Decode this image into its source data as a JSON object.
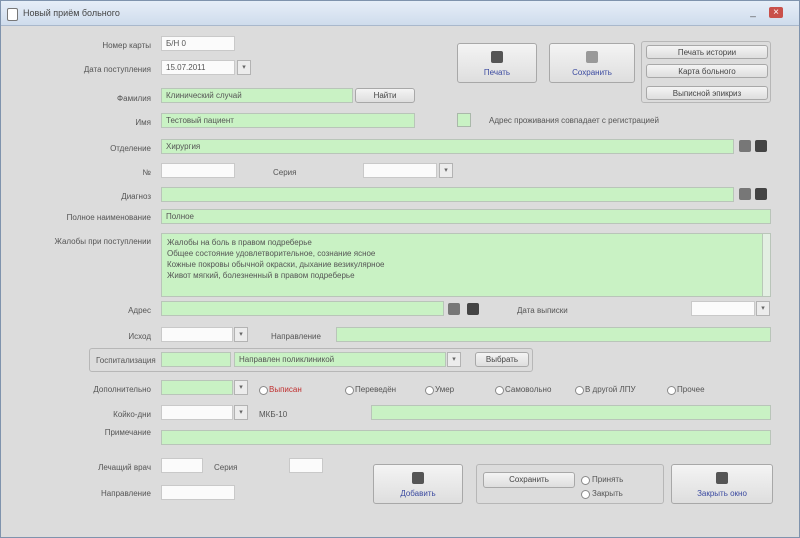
{
  "window": {
    "title": "Новый приём больного",
    "min": "_",
    "max": "□",
    "close": "×"
  },
  "labels": {
    "card_number": "Номер карты",
    "admission_date": "Дата поступления",
    "last_name": "Фамилия",
    "first_name": "Имя",
    "department": "Отделение",
    "number": "№",
    "series": "Серия",
    "diagnosis": "Диагноз",
    "surname_variant": "Полное наименование",
    "complaints": "Жалобы при поступлении",
    "address": "Адрес",
    "result_date": "Дата выписки",
    "outcome": "Исход",
    "referral": "Направление",
    "stay": "Госпитализация",
    "additional": "Дополнительно",
    "days_count": "Койко-дни",
    "notes": "Примечание",
    "doctor": "Лечащий врач"
  },
  "values": {
    "card_number": "Б/Н 0",
    "admission_date": "15.07.2011",
    "last_name": "Клинический случай",
    "first_name": "Тестовый пациент",
    "department": "Хирургия",
    "diagnosis": "",
    "full_name": "Полное",
    "complaints_line1": "Жалобы на боль в правом подреберье",
    "complaints_line2": "Общее состояние удовлетворительное, сознание ясное",
    "complaints_line3": "Кожные покровы обычной окраски, дыхание везикулярное",
    "complaints_line4": "Живот мягкий, болезненный в правом подреберье",
    "referral_text": "Направлен поликлиникой"
  },
  "buttons": {
    "find": "Найти",
    "print": "Печать",
    "save_record": "Сохранить",
    "history": "Печать истории",
    "card_print": "Карта больного",
    "extract_print": "Выписной эпикриз",
    "add": "Добавить",
    "save": "Сохранить",
    "exit": "Закрыть окно",
    "accept": "Принять",
    "close_bottom": "Закрыть"
  },
  "checkbox": {
    "same_address": "Адрес проживания совпадает с регистрацией"
  },
  "radios": [
    "Выписан",
    "Переведён",
    "Умер",
    "Самовольно",
    "В другой ЛПУ",
    "Прочее"
  ],
  "status": {
    "diag_select": "Выбрать",
    "mkb": "МКБ-10"
  }
}
